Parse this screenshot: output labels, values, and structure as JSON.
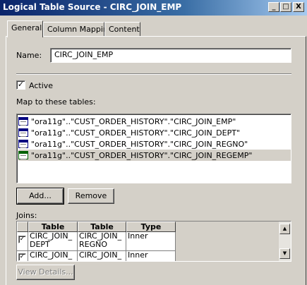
{
  "window": {
    "title": "Logical Table Source - CIRC_JOIN_EMP",
    "min_glyph": "_",
    "max_glyph": "□",
    "close_glyph": "X"
  },
  "tabs": [
    {
      "label": "General",
      "active": true
    },
    {
      "label": "Column Mapping",
      "active": false
    },
    {
      "label": "Content",
      "active": false
    }
  ],
  "name_field": {
    "label": "Name:",
    "value": "CIRC_JOIN_EMP"
  },
  "active_checkbox": {
    "label": "Active",
    "checked": true,
    "mark": "✓"
  },
  "map_tables": {
    "label": "Map to these tables:",
    "items": [
      {
        "text": "\"ora11g\"..\"CUST_ORDER_HISTORY\".\"CIRC_JOIN_EMP\"",
        "icon": "table-icon"
      },
      {
        "text": "\"ora11g\"..\"CUST_ORDER_HISTORY\".\"CIRC_JOIN_DEPT\"",
        "icon": "table-icon"
      },
      {
        "text": "\"ora11g\"..\"CUST_ORDER_HISTORY\".\"CIRC_JOIN_REGNO\"",
        "icon": "table-icon"
      },
      {
        "text": "\"ora11g\"..\"CUST_ORDER_HISTORY\".\"CIRC_JOIN_REGEMP\"",
        "icon": "table-icon",
        "selected": true
      }
    ]
  },
  "buttons": {
    "add": "Add...",
    "remove": "Remove",
    "view_details": "View Details..."
  },
  "joins": {
    "label": "Joins:",
    "headers": [
      "Table",
      "Table",
      "Type"
    ],
    "rows": [
      {
        "checked": true,
        "mark": "✓",
        "table1": "CIRC_JOIN_DEPT",
        "table1_lines": [
          "CIRC_JOIN_",
          "DEPT"
        ],
        "table2_lines": [
          "CIRC_JOIN_",
          "REGNO"
        ],
        "type": "Inner"
      },
      {
        "checked": true,
        "mark": "✓",
        "table1_lines": [
          "CIRC_JOIN_"
        ],
        "table2_lines": [
          "CIRC_JOIN_"
        ],
        "type": "Inner"
      }
    ]
  },
  "scroll_glyphs": {
    "up": "▲",
    "down": "▼"
  }
}
